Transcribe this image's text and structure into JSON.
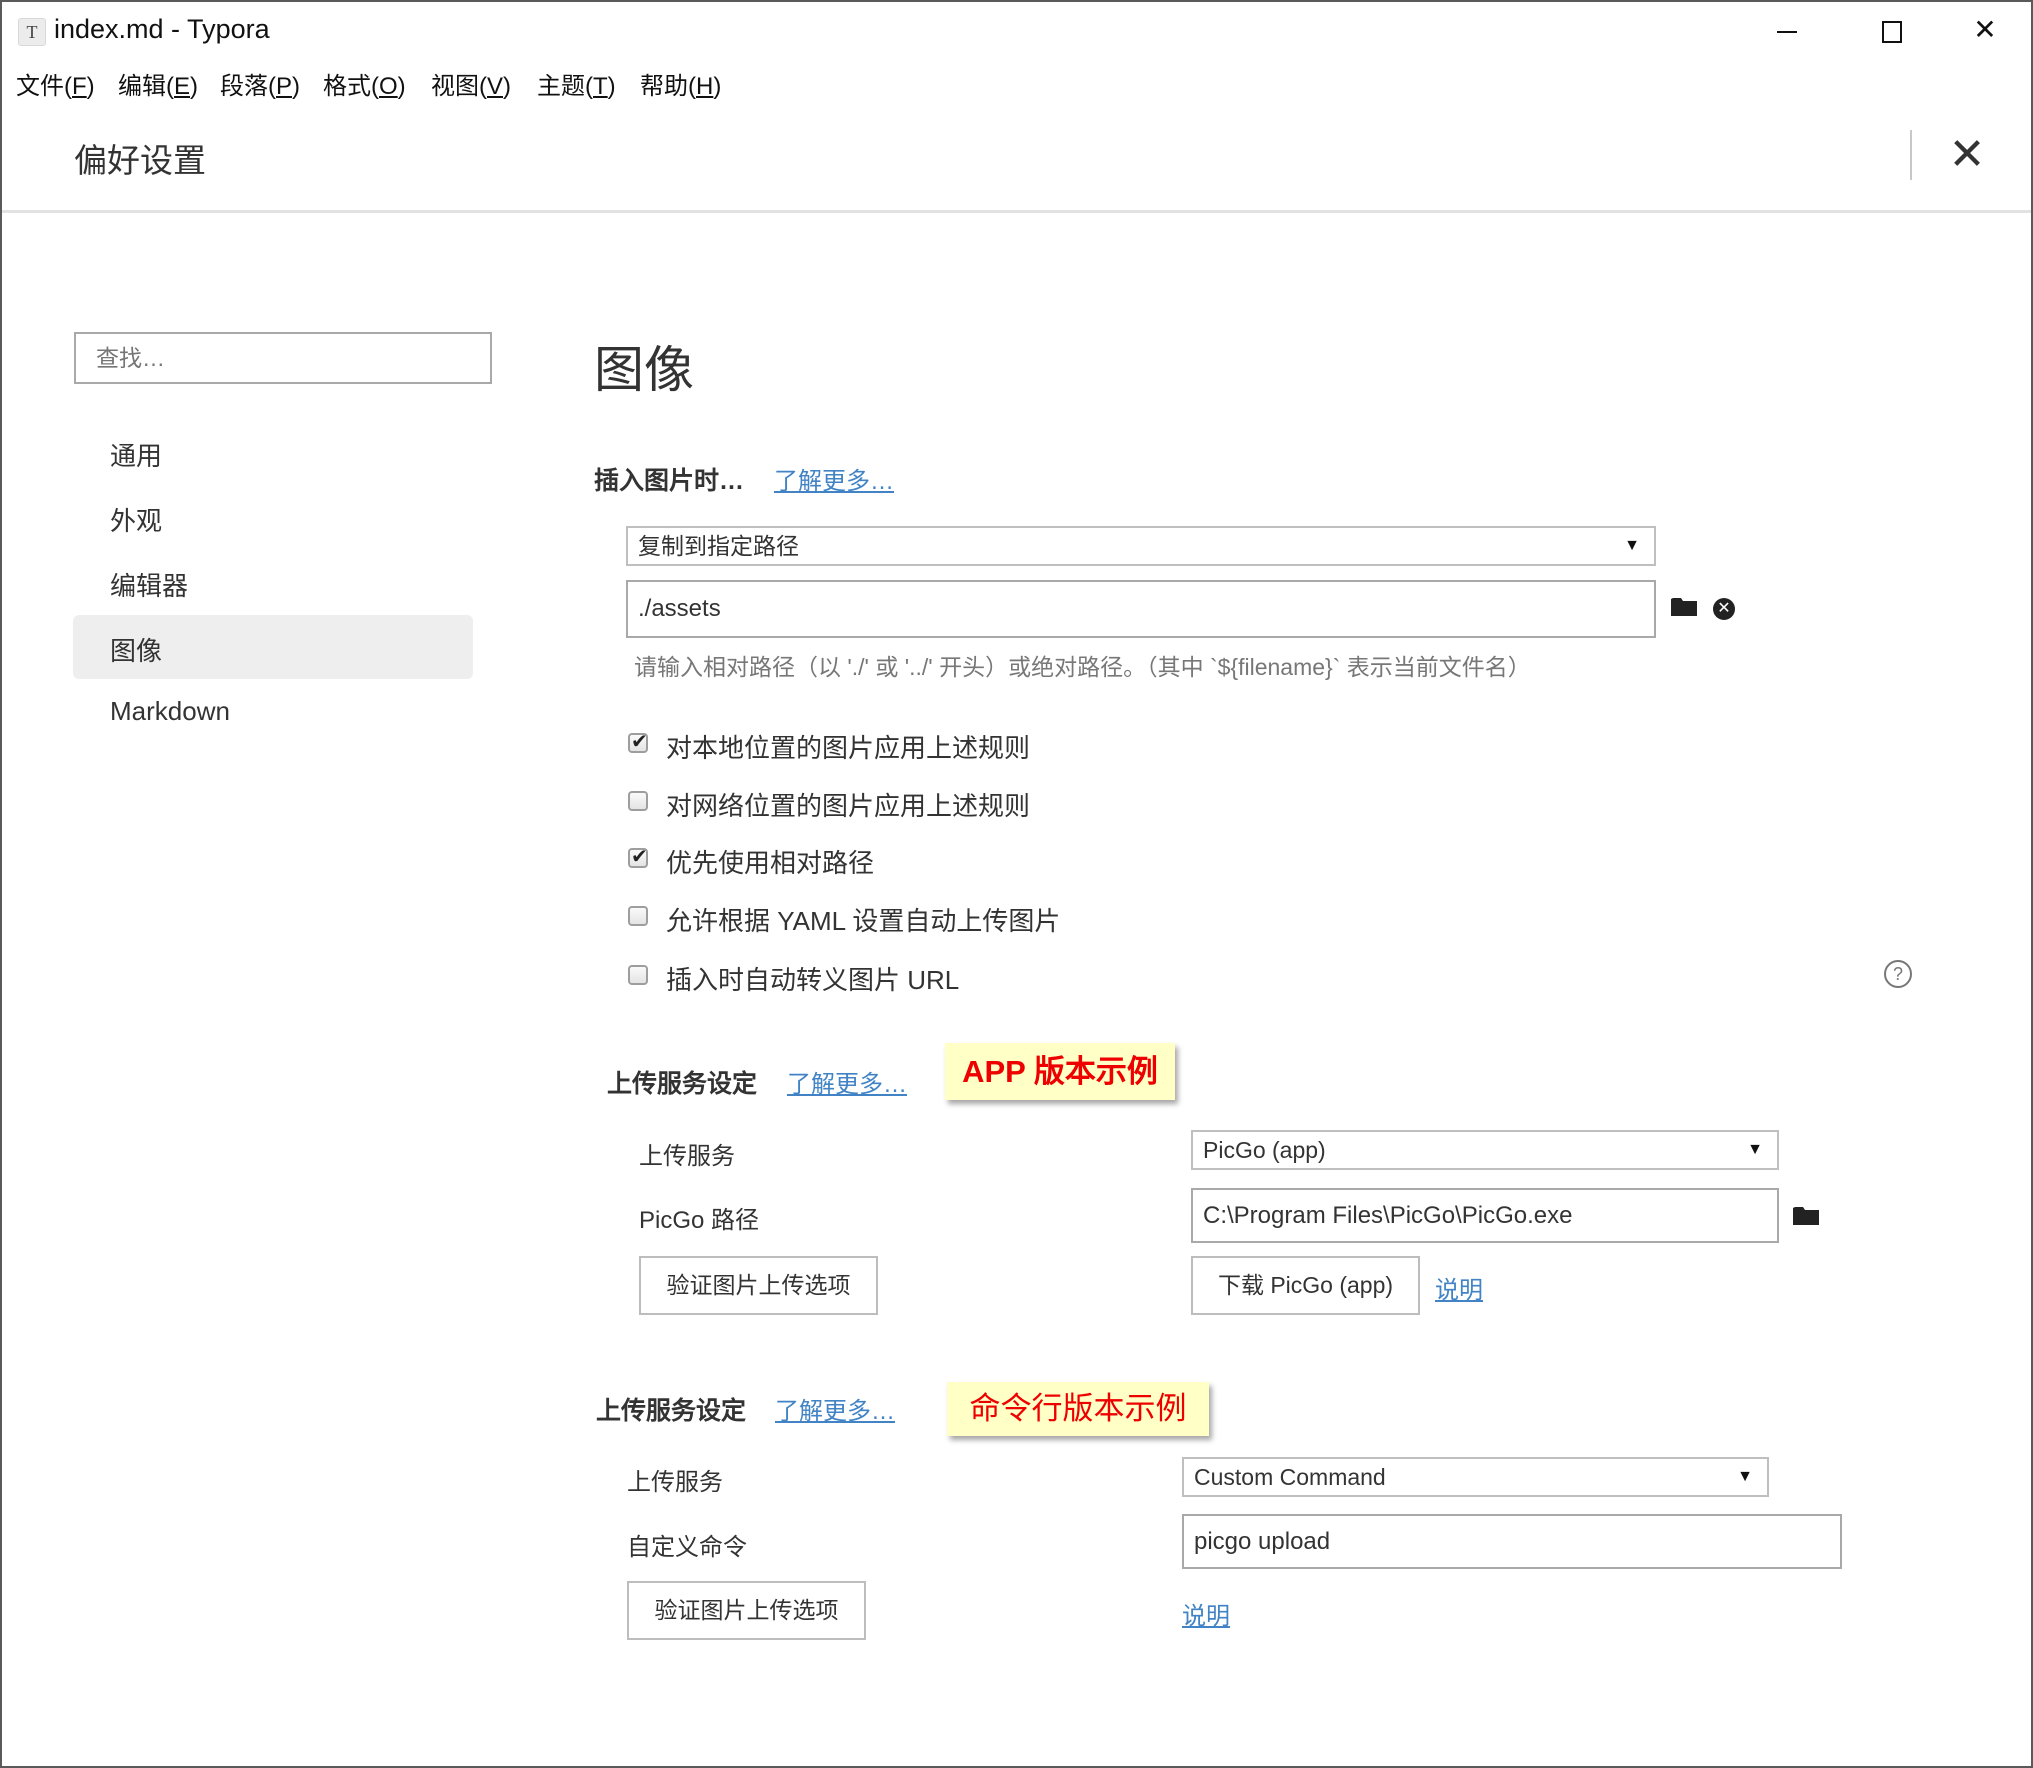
{
  "window": {
    "icon_glyph": "T",
    "title": "index.md - Typora",
    "controls": {
      "minimize": "—",
      "maximize": "☐",
      "close": "✕"
    }
  },
  "menu": [
    {
      "label": "文件",
      "key": "F"
    },
    {
      "label": "编辑",
      "key": "E"
    },
    {
      "label": "段落",
      "key": "P"
    },
    {
      "label": "格式",
      "key": "O"
    },
    {
      "label": "视图",
      "key": "V"
    },
    {
      "label": "主题",
      "key": "T"
    },
    {
      "label": "帮助",
      "key": "H"
    }
  ],
  "prefs": {
    "title": "偏好设置",
    "close_glyph": "✕"
  },
  "sidebar": {
    "search_placeholder": "查找…",
    "items": [
      {
        "label": "通用",
        "active": false
      },
      {
        "label": "外观",
        "active": false
      },
      {
        "label": "编辑器",
        "active": false
      },
      {
        "label": "图像",
        "active": true
      },
      {
        "label": "Markdown",
        "active": false
      }
    ]
  },
  "main": {
    "heading": "图像",
    "insert_section": {
      "title": "插入图片时…",
      "learn_more": "了解更多…",
      "action_select": "复制到指定路径",
      "path_value": "./assets",
      "path_hint": "请输入相对路径（以 './' 或 '../' 开头）或绝对路径。（其中 `${filename}` 表示当前文件名）",
      "checkboxes": [
        {
          "label": "对本地位置的图片应用上述规则",
          "checked": true
        },
        {
          "label": "对网络位置的图片应用上述规则",
          "checked": false
        },
        {
          "label": "优先使用相对路径",
          "checked": true
        },
        {
          "label": "允许根据 YAML 设置自动上传图片",
          "checked": false
        },
        {
          "label": "插入时自动转义图片 URL",
          "checked": false
        }
      ]
    },
    "upload_app": {
      "title": "上传服务设定",
      "learn_more": "了解更多…",
      "note": "APP 版本示例",
      "service_label": "上传服务",
      "service_value": "PicGo (app)",
      "path_label": "PicGo 路径",
      "path_value": "C:\\Program Files\\PicGo\\PicGo.exe",
      "verify_button": "验证图片上传选项",
      "download_button": "下载 PicGo (app)",
      "help_link": "说明"
    },
    "upload_cmd": {
      "title": "上传服务设定",
      "learn_more": "了解更多…",
      "note": "命令行版本示例",
      "service_label": "上传服务",
      "service_value": "Custom Command",
      "command_label": "自定义命令",
      "command_value": "picgo upload",
      "verify_button": "验证图片上传选项",
      "help_link": "说明"
    }
  },
  "icons": {
    "dropdown_arrow": "▼",
    "check": "✔",
    "clear": "✕",
    "help": "?"
  },
  "colors": {
    "link": "#4183c4",
    "note_bg": "#ffffc6",
    "note_text": "#ee0000",
    "sidebar_active_bg": "#eeeeee"
  }
}
